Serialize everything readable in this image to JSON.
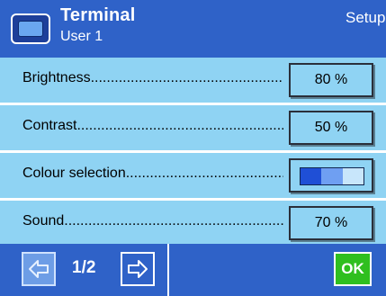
{
  "header": {
    "title": "Terminal",
    "subtitle": "User 1",
    "mode": "Setup",
    "icon": "terminal-icon"
  },
  "settings": [
    {
      "label": "Brightness",
      "value": "80 %"
    },
    {
      "label": "Contrast",
      "value": "50 %"
    },
    {
      "label": "Colour selection",
      "value": ""
    },
    {
      "label": "Sound",
      "value": "70 %"
    }
  ],
  "colour_selection": {
    "segments": [
      "#1f4fd6",
      "#6f9ff2",
      "#c8e6fb"
    ]
  },
  "footer": {
    "page": "1/2",
    "prev_icon": "arrow-left-icon",
    "next_icon": "arrow-right-icon",
    "ok_label": "OK"
  },
  "colors": {
    "header_bg": "#2f62c8",
    "content_bg": "#8fd3f3",
    "ok_green": "#2fbf1f"
  }
}
